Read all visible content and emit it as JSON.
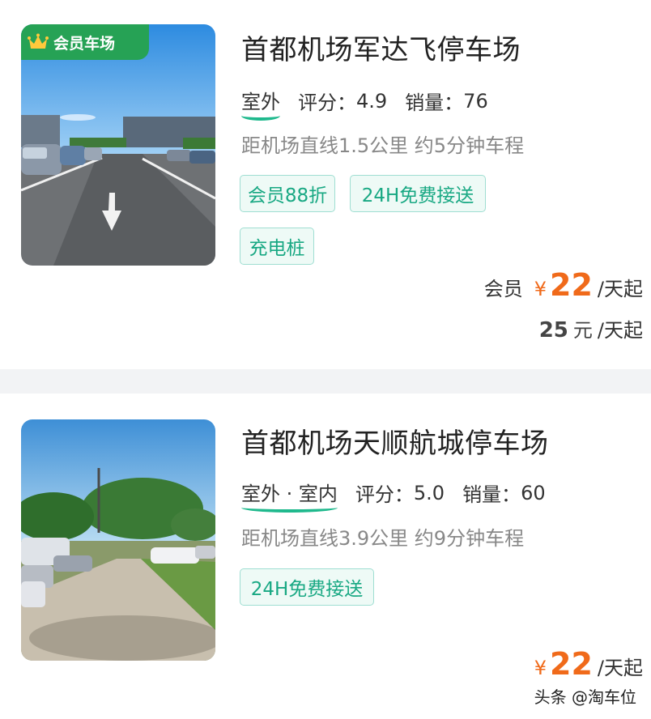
{
  "listings": [
    {
      "badge": "会员车场",
      "title": "首都机场军达飞停车场",
      "location": "室外",
      "rating_label": "评分：",
      "rating": "4.9",
      "sales_label": "销量：",
      "sales": "76",
      "distance": "距机场直线1.5公里 约5分钟车程",
      "tags": [
        "会员88折",
        "24H免费接送",
        "充电桩"
      ],
      "member_label": "会员",
      "currency": "¥",
      "member_price": "22",
      "price_unit": "/天起",
      "normal_price": "25",
      "normal_currency": "元",
      "normal_unit": "/天起"
    },
    {
      "title": "首都机场天顺航城停车场",
      "location": "室外 · 室内",
      "rating_label": "评分：",
      "rating": "5.0",
      "sales_label": "销量：",
      "sales": "60",
      "distance": "距机场直线3.9公里 约9分钟车程",
      "tags": [
        "24H免费接送"
      ],
      "currency": "¥",
      "price": "22",
      "price_unit": "/天起"
    }
  ],
  "watermark": "头条 @淘车位",
  "colors": {
    "badge_green": "#26a255",
    "tag_text": "#18a883",
    "tag_border": "#9fded2",
    "price_orange": "#f06a1a"
  }
}
